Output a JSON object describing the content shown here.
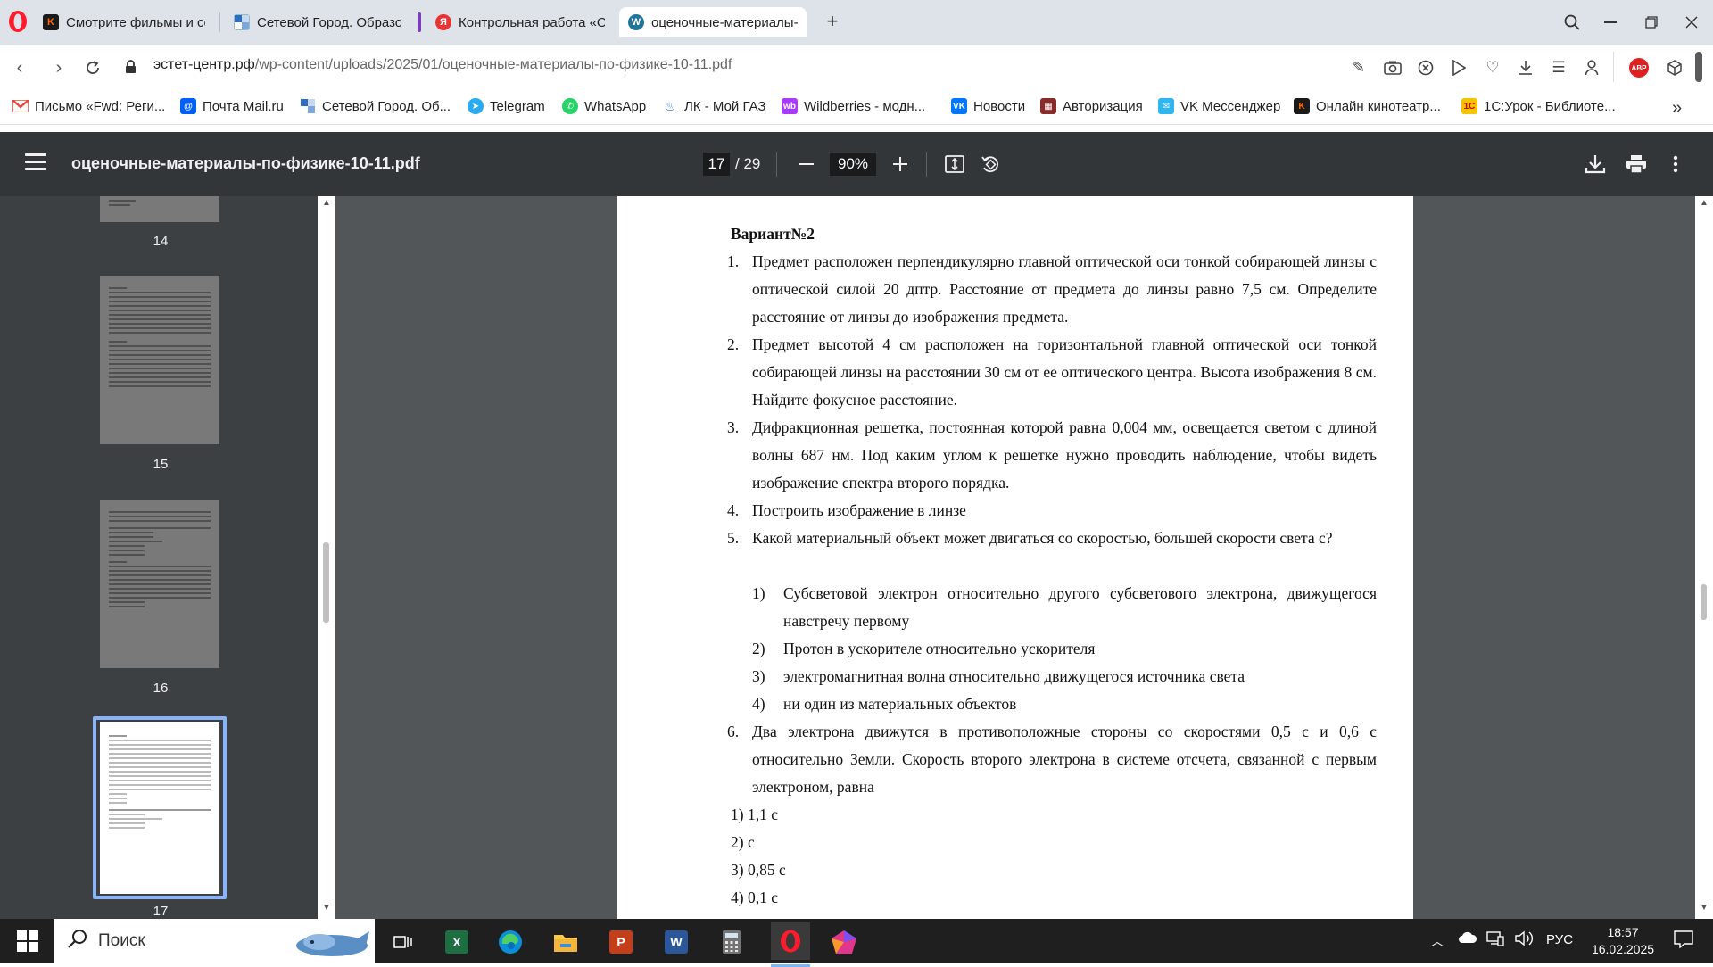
{
  "browser": {
    "tabs": [
      {
        "label": "Смотрите фильмы и сери",
        "favicon": "kinopoisk-icon",
        "color": "#ff4e00"
      },
      {
        "label": "Сетевой Город. Образова",
        "favicon": "netcity-icon",
        "color": "#2b6cc4"
      },
      {
        "label": "Контрольная работа «Оп",
        "favicon": "yandex-icon",
        "color": "#e73535"
      },
      {
        "label": "оценочные-материалы-г",
        "favicon": "wordpress-icon",
        "color": "#21759b"
      }
    ],
    "url_host": "эстет-центр.рф",
    "url_path": "/wp-content/uploads/2025/01/оценочные-материалы-по-физике-10-11.pdf",
    "bookmarks": [
      {
        "label": "Письмо «Fwd: Реги...",
        "icon": "gmail-icon",
        "color": "#ea4335"
      },
      {
        "label": "Почта Mail.ru",
        "icon": "mail-ru-icon",
        "color": "#005ff9"
      },
      {
        "label": "Сетевой Город. Об...",
        "icon": "netcity-icon",
        "color": "#2b6cc4"
      },
      {
        "label": "Telegram",
        "icon": "telegram-icon",
        "color": "#2aabee"
      },
      {
        "label": "WhatsApp",
        "icon": "whatsapp-icon",
        "color": "#25d366"
      },
      {
        "label": "ЛК - Мой ГАЗ",
        "icon": "gas-icon",
        "color": "#1e6bd6"
      },
      {
        "label": "Wildberries - модн...",
        "icon": "wildberries-icon",
        "color": "#a73afd"
      },
      {
        "label": "Новости",
        "icon": "vk-icon",
        "color": "#0077ff"
      },
      {
        "label": "Авторизация",
        "icon": "auth-icon",
        "color": "#8a2b2b"
      },
      {
        "label": "VK Мессенджер",
        "icon": "vk-messenger-icon",
        "color": "#2fb5f0"
      },
      {
        "label": "Онлайн кинотеатр...",
        "icon": "kinopoisk-icon",
        "color": "#ff4e00"
      },
      {
        "label": "1С:Урок - Библиоте...",
        "icon": "1c-icon",
        "color": "#f5c400"
      }
    ]
  },
  "pdf": {
    "title": "оценочные-материалы-по-физике-10-11.pdf",
    "current_page": "17",
    "total_pages": "/ 29",
    "zoom": "90%",
    "thumbnails": [
      "14",
      "15",
      "16",
      "17"
    ]
  },
  "document": {
    "variant": "Вариант№2",
    "questions": [
      {
        "num": "1.",
        "text": "Предмет расположен перпендикулярно главной оптической оси тонкой собирающей линзы с оптической силой 20 дптр. Расстояние от предмета до линзы равно 7,5 см. Определите расстояние от линзы до изображения предмета."
      },
      {
        "num": "2.",
        "text": "Предмет высотой 4 см расположен на горизонтальной главной оптической оси тонкой собирающей линзы на расстоянии 30 см от ее оптического центра. Высота изображения 8 см. Найдите фокусное расстояние."
      },
      {
        "num": "3.",
        "text": "Дифракционная решетка, постоянная которой равна 0,004 мм, освещается светом с длиной волны 687 нм. Под каким углом к решетке нужно проводить наблюдение, чтобы видеть изображение спектра второго порядка."
      },
      {
        "num": "4.",
        "text": "Построить изображение в линзе"
      },
      {
        "num": "5.",
        "text": "Какой материальный объект может двигаться со скоростью, большей скорости света с?"
      },
      {
        "num": "6.",
        "text": "Два электрона движутся в противоположные стороны со скоростями 0,5 с и 0,6 с относительно Земли. Скорость второго электрона в системе отсчета, связанной с первым электроном, равна"
      }
    ],
    "q5_options": [
      {
        "num": "1)",
        "text": "Субсветовой электрон относительно другого субсветового электрона, движущегося навстречу первому"
      },
      {
        "num": "2)",
        "text": "Протон в ускорителе относительно ускорителя"
      },
      {
        "num": "3)",
        "text": "электромагнитная волна относительно движущегося источника света"
      },
      {
        "num": "4)",
        "text": "ни один из материальных объектов"
      }
    ],
    "q6_answers": [
      "1) 1,1 с",
      "2) с",
      "3) 0,85 с",
      "4) 0,1 с"
    ]
  },
  "taskbar": {
    "search_placeholder": "Поиск",
    "language": "РУС",
    "time": "18:57",
    "date": "16.02.2025",
    "apps": [
      "task-view-icon",
      "excel-icon",
      "edge-icon",
      "file-explorer-icon",
      "powerpoint-icon",
      "word-icon",
      "calculator-icon",
      "opera-icon",
      "app-icon"
    ]
  }
}
